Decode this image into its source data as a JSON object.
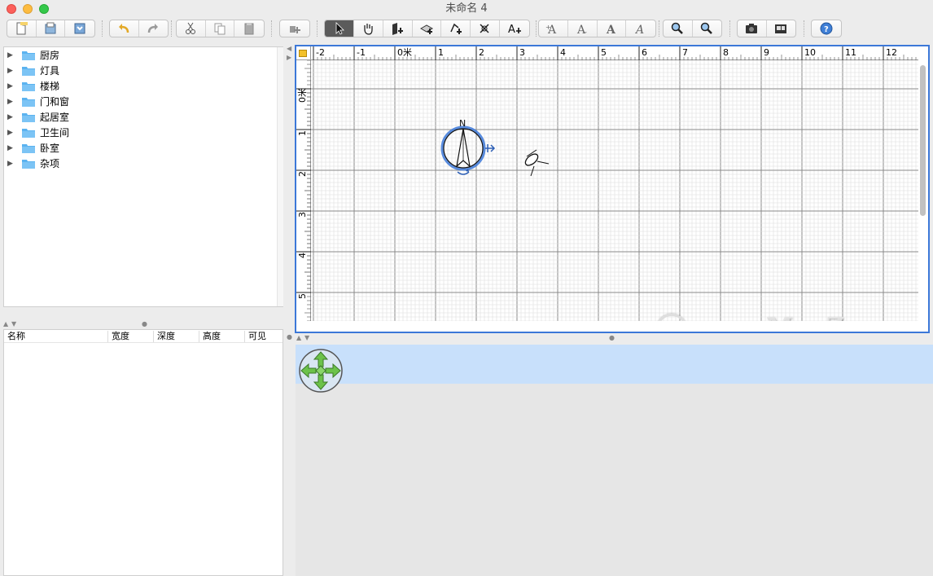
{
  "window": {
    "title": "未命名 4"
  },
  "toolbar": {
    "icons": [
      "new-file-icon",
      "open-file-icon",
      "save-file-icon",
      "undo-icon",
      "redo-icon",
      "cut-icon",
      "copy-icon",
      "paste-icon",
      "add-furniture-icon",
      "select-arrow-icon",
      "pan-hand-icon",
      "create-walls-icon",
      "create-rooms-icon",
      "create-polylines-icon",
      "create-dimensions-icon",
      "add-text-icon",
      "increase-text-size-icon",
      "decrease-text-size-icon",
      "bold-text-icon",
      "italic-text-icon",
      "zoom-in-icon",
      "zoom-out-icon",
      "create-photo-icon",
      "create-video-icon",
      "help-icon"
    ]
  },
  "catalog": {
    "categories": [
      {
        "label": "厨房"
      },
      {
        "label": "灯具"
      },
      {
        "label": "楼梯"
      },
      {
        "label": "门和窗"
      },
      {
        "label": "起居室"
      },
      {
        "label": "卫生间"
      },
      {
        "label": "卧室"
      },
      {
        "label": "杂项"
      }
    ]
  },
  "furniture_list": {
    "columns": [
      "名称",
      "宽度",
      "深度",
      "高度",
      "可见"
    ]
  },
  "plan": {
    "ruler_top": [
      "-2",
      "-1",
      "0米",
      "1",
      "2",
      "3",
      "4",
      "5",
      "6",
      "7",
      "8",
      "9",
      "10",
      "11",
      "12"
    ],
    "ruler_left": [
      "0米",
      "1",
      "2",
      "3",
      "4",
      "5"
    ],
    "compass_label": "N",
    "watermark": "www.MacZ.com"
  },
  "colors": {
    "accent": "#3c78d8",
    "selection_band": "#c8e0fb",
    "folder": "#5bb3f0",
    "nav_green": "#6cc24a"
  }
}
